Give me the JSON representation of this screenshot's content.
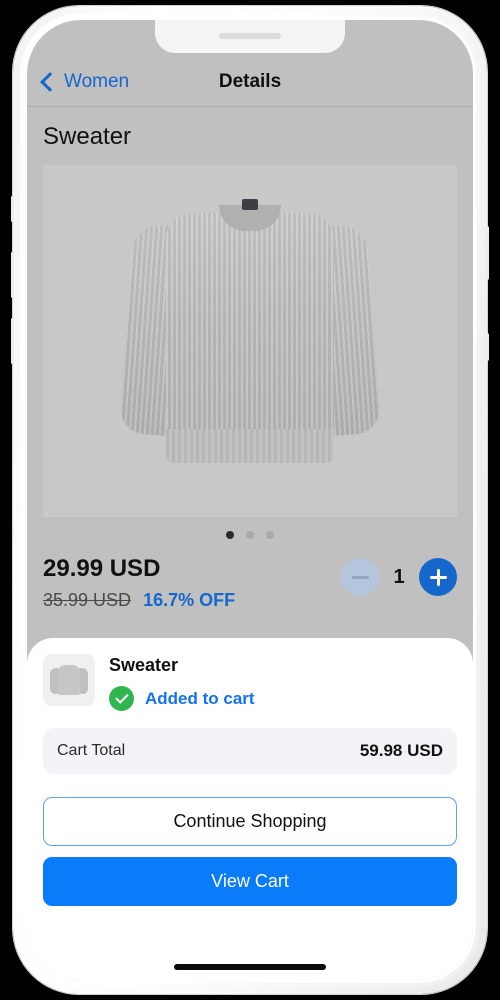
{
  "navbar": {
    "back_label": "Women",
    "title": "Details",
    "back_icon": "chevron-left-icon"
  },
  "product": {
    "title": "Sweater",
    "price": "29.99 USD",
    "original_price": "35.99 USD",
    "discount": "16.7% OFF",
    "quantity": "1",
    "minus_label": "−",
    "plus_label": "+",
    "image_alt": "gray knit sweater"
  },
  "carousel": {
    "total_dots": 3,
    "active_index": 0
  },
  "sheet": {
    "item_name": "Sweater",
    "status_text": "Added to cart",
    "status_icon": "check-circle-icon",
    "total_label": "Cart Total",
    "total_value": "59.98 USD",
    "continue_label": "Continue Shopping",
    "view_cart_label": "View Cart"
  },
  "colors": {
    "accent_blue": "#0a7cfa",
    "link_blue": "#1667cc",
    "success_green": "#2fb64e",
    "dim_overlay": "#c0c0c0"
  }
}
